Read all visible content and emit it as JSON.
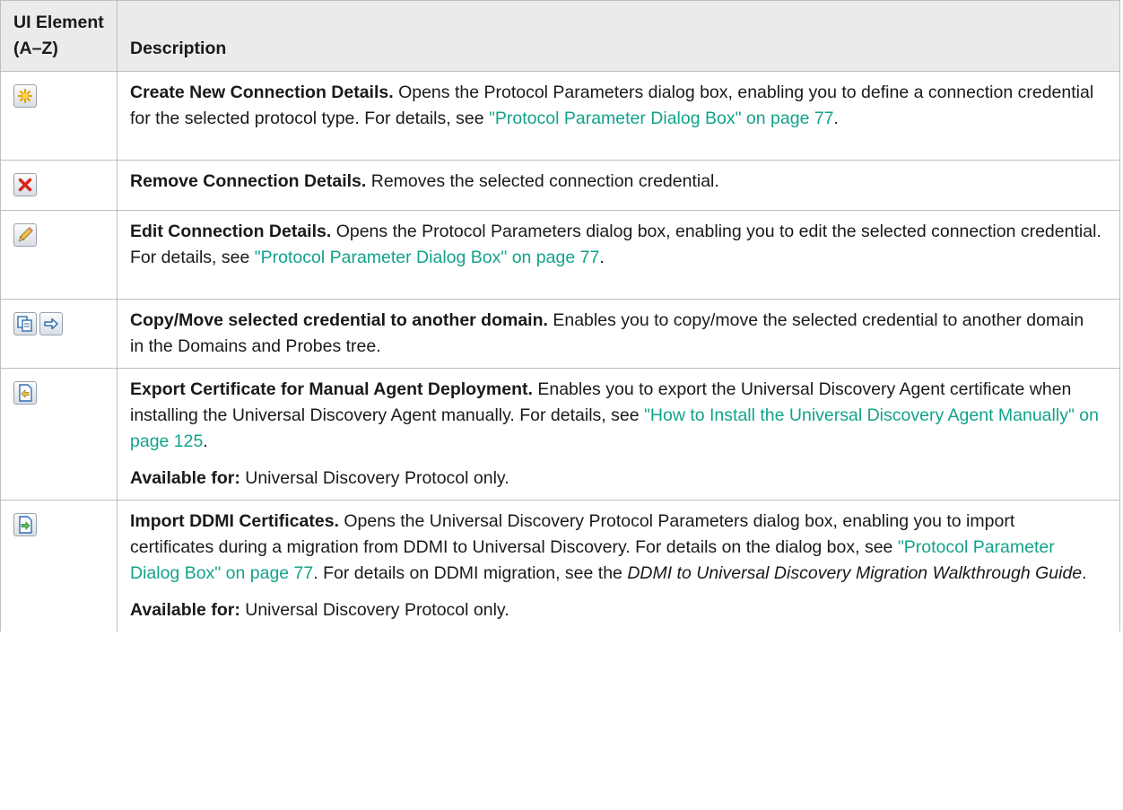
{
  "header": {
    "col1": "UI Element (A–Z)",
    "col2": "Description"
  },
  "colors": {
    "link": "#12a38a",
    "header_bg": "#ebebeb",
    "border": "#bfbfbf"
  },
  "rows": [
    {
      "icon": "create-new-icon",
      "title": "Create New Connection Details.",
      "text": " Opens the Protocol Parameters dialog box, enabling you to define a connection credential for the selected protocol type. For details, see ",
      "link": "\"Protocol Parameter Dialog Box\" on page 77",
      "after": "."
    },
    {
      "icon": "remove-icon",
      "title": "Remove Connection Details.",
      "text": " Removes the selected connection credential."
    },
    {
      "icon": "edit-pencil-icon",
      "title": "Edit Connection Details.",
      "text": " Opens the Protocol Parameters dialog box, enabling you to edit the selected connection credential. For details, see ",
      "link": "\"Protocol Parameter Dialog Box\" on page 77",
      "after": "."
    },
    {
      "icons": [
        "copy-icon",
        "move-arrow-icon"
      ],
      "title": "Copy/Move selected credential to another domain.",
      "text": " Enables you to copy/move the selected credential to another domain in the Domains and Probes tree."
    },
    {
      "icon": "export-certificate-icon",
      "title": "Export Certificate for Manual Agent Deployment.",
      "text": " Enables you to export the Universal Discovery Agent certificate when installing the Universal Discovery Agent manually. For details, see ",
      "link": "\"How to Install the Universal Discovery Agent Manually\" on page 125",
      "after": ".",
      "note_label": "Available for:",
      "note_text": " Universal Discovery Protocol only."
    },
    {
      "icon": "import-certificate-icon",
      "title": "Import DDMI Certificates.",
      "text": " Opens the Universal Discovery Protocol Parameters dialog box, enabling you to import certificates during a migration from DDMI to Universal Discovery. For details on the dialog box, see ",
      "link": "\"Protocol Parameter Dialog Box\" on page 77",
      "after": ". For details on DDMI migration, see the ",
      "italic": "DDMI to Universal Discovery Migration Walkthrough Guide",
      "after2": ".",
      "note_label": "Available for:",
      "note_text": " Universal Discovery Protocol only."
    }
  ]
}
